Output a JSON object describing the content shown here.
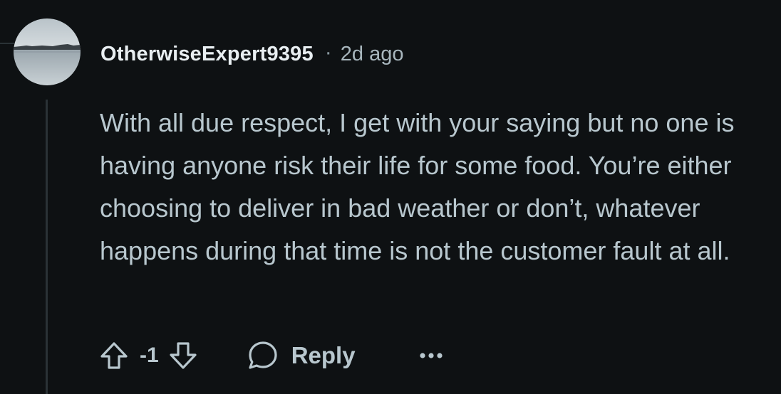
{
  "comment": {
    "author": "OtherwiseExpert9395",
    "separator": "·",
    "age": "2d ago",
    "text": "With all due respect, I get with your saying but no one is having anyone risk their life for some food. You’re either choosing to deliver in bad weather or don’t, whatever happens during that time is not the customer fault at all.",
    "vote_count": "-1",
    "reply_label": "Reply",
    "icons": {
      "avatar": "lake-landscape-avatar",
      "upvote": "arrow-up-outline-icon",
      "downvote": "arrow-down-outline-icon",
      "reply": "speech-bubble-icon",
      "more": "ellipsis-icon"
    }
  },
  "colors": {
    "background": "#0e1113",
    "username": "#e8eef1",
    "text": "#b8c7ce",
    "thread_line": "#2a3236"
  }
}
